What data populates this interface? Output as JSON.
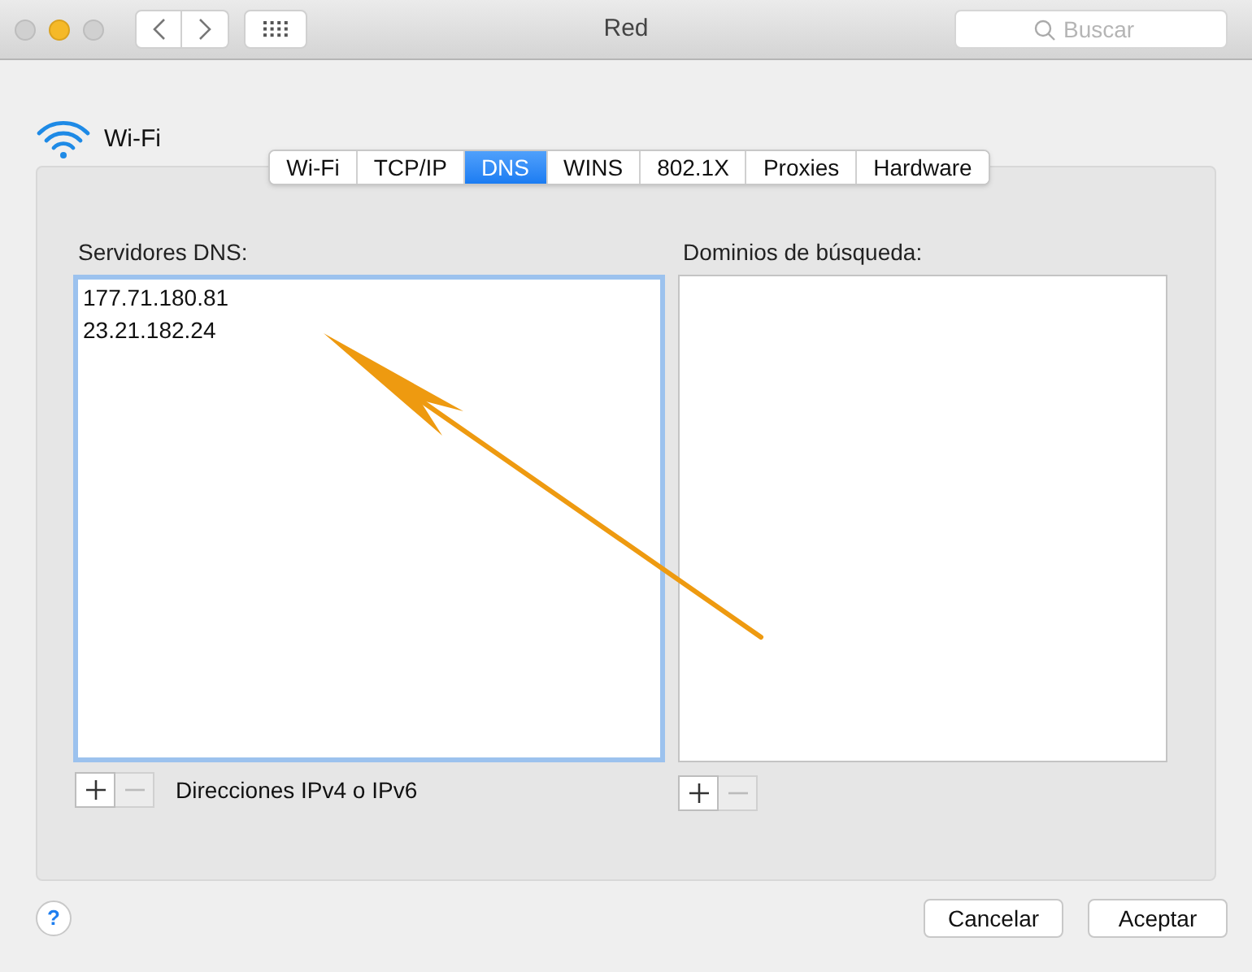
{
  "window": {
    "title": "Red"
  },
  "search": {
    "placeholder": "Buscar"
  },
  "interface": {
    "name": "Wi-Fi"
  },
  "tabs": [
    {
      "label": "Wi-Fi",
      "selected": false
    },
    {
      "label": "TCP/IP",
      "selected": false
    },
    {
      "label": "DNS",
      "selected": true
    },
    {
      "label": "WINS",
      "selected": false
    },
    {
      "label": "802.1X",
      "selected": false
    },
    {
      "label": "Proxies",
      "selected": false
    },
    {
      "label": "Hardware",
      "selected": false
    }
  ],
  "dns_servers": {
    "label": "Servidores DNS:",
    "focused": true,
    "entries": [
      "177.71.180.81",
      "23.21.182.24"
    ],
    "hint": "Direcciones IPv4 o IPv6"
  },
  "search_domains": {
    "label": "Dominios de búsqueda:",
    "focused": false
  },
  "help": {
    "label": "?"
  },
  "buttons": [
    {
      "label": "Cancelar"
    },
    {
      "label": "Aceptar"
    }
  ]
}
